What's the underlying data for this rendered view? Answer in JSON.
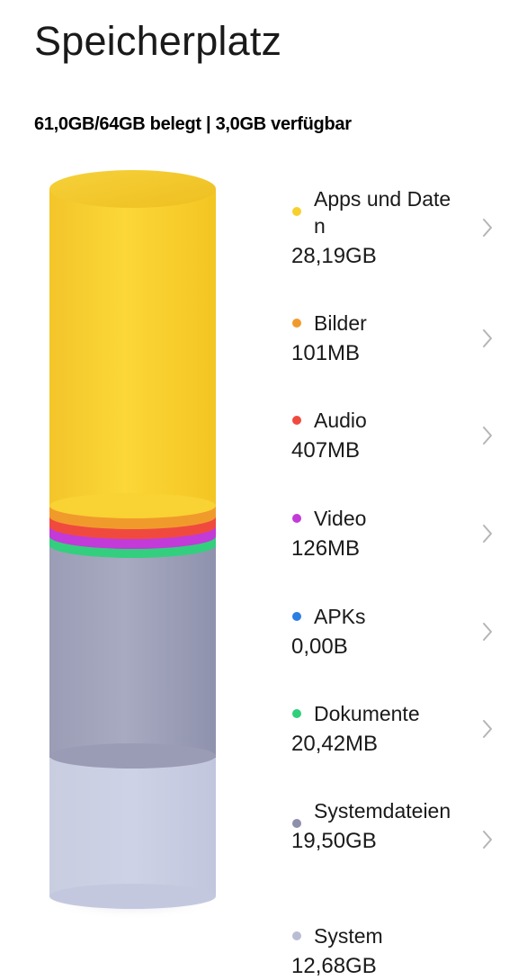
{
  "header": {
    "title": "Speicherplatz",
    "usage_summary": "61,0GB/64GB belegt | 3,0GB verfügbar"
  },
  "categories": [
    {
      "name": "Apps und Daten",
      "size": "28,19GB",
      "color": "#f7d02c",
      "icon": "dot-icon"
    },
    {
      "name": "Bilder",
      "size": "101MB",
      "color": "#f19a2c",
      "icon": "dot-icon"
    },
    {
      "name": "Audio",
      "size": "407MB",
      "color": "#f04a3f",
      "icon": "dot-icon"
    },
    {
      "name": "Video",
      "size": "126MB",
      "color": "#c23ad8",
      "icon": "dot-icon"
    },
    {
      "name": "APKs",
      "size": "0,00B",
      "color": "#2b7ee3",
      "icon": "dot-icon"
    },
    {
      "name": "Dokumente",
      "size": "20,42MB",
      "color": "#2fd07c",
      "icon": "dot-icon"
    },
    {
      "name": "Systemdateien",
      "size": "19,50GB",
      "color": "#8d8fab",
      "icon": "dot-icon"
    },
    {
      "name": "System",
      "size": "12,68GB",
      "color": "#b9bdd4",
      "icon": "dot-icon"
    }
  ],
  "chevron_icon": "chevron-right-icon"
}
